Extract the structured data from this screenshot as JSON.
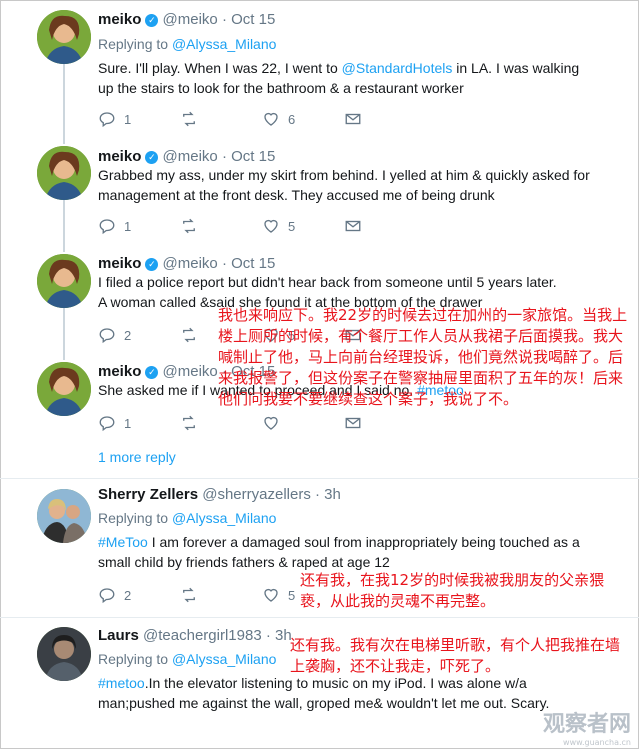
{
  "tweets": [
    {
      "name": "meiko",
      "handle": "@meiko",
      "date": "Oct 15",
      "replying_prefix": "Replying to ",
      "replying_to": "@Alyssa_Milano",
      "body_pre": "Sure. I'll play. When I was 22, I went to ",
      "body_link": "@StandardHotels",
      "body_post": " in LA. I was walking up the stairs to look for the bathroom & a restaurant worker",
      "replies": "1",
      "retweets": "",
      "likes": "6"
    },
    {
      "name": "meiko",
      "handle": "@meiko",
      "date": "Oct 15",
      "body": "Grabbed my ass, under my skirt from behind. I yelled at him & quickly asked for management at the front desk. They accused me of being drunk",
      "replies": "1",
      "retweets": "",
      "likes": "5"
    },
    {
      "name": "meiko",
      "handle": "@meiko",
      "date": "Oct 15",
      "body": "I filed a police report but didn't hear back from someone until 5 years later. A woman called &said she found it at the bottom of the drawer",
      "replies": "2",
      "retweets": "",
      "likes": "5"
    },
    {
      "name": "meiko",
      "handle": "@meiko",
      "date": "Oct 15",
      "body_pre": "She asked me if I wanted to proceed and I said no. ",
      "body_tag": "#metoo",
      "replies": "1",
      "retweets": "",
      "likes": ""
    },
    {
      "name": "Sherry Zellers",
      "handle": "@sherryazellers",
      "date": "3h",
      "replying_prefix": "Replying to ",
      "replying_to": "@Alyssa_Milano",
      "body_tag": "#MeToo",
      "body_post": " I am forever a damaged soul from inappropriately being touched as a small child by friends fathers & raped at age 12",
      "replies": "2",
      "retweets": "",
      "likes": "5"
    },
    {
      "name": "Laurs",
      "handle": "@teachergirl1983",
      "date": "3h",
      "replying_prefix": "Replying to ",
      "replying_to": "@Alyssa_Milano",
      "body_tag": "#metoo",
      "body_post": ".In the elevator listening to music on my iPod. I was alone w/a man;pushed me against the wall, groped me& wouldn't let me out. Scary."
    }
  ],
  "more_replies": "1 more reply",
  "dot": "·",
  "annotations": {
    "a1": "我也来响应下。我22岁的时候去过在加州的一家旅馆。当我上楼上厕所的时候，有个餐厅工作人员从我裙子后面摸我。我大喊制止了他，马上向前台经理投诉，他们竟然说我喝醉了。后来我报警了，但这份案子在警察抽屉里面积了五年的灰！后来他们问我要不要继续查这个案子，我说了不。",
    "a2": "还有我，在我12岁的时候我被我朋友的父亲猥亵，从此我的灵魂不再完整。",
    "a3": "还有我。我有次在电梯里听歌，有个人把我推在墙上袭胸，还不让我走，吓死了。"
  },
  "watermark": {
    "main": "观察者网",
    "sub": "www.guancha.cn"
  },
  "colors": {
    "link": "#1da1f2",
    "annotation": "#e8141c",
    "meta": "#657786"
  }
}
